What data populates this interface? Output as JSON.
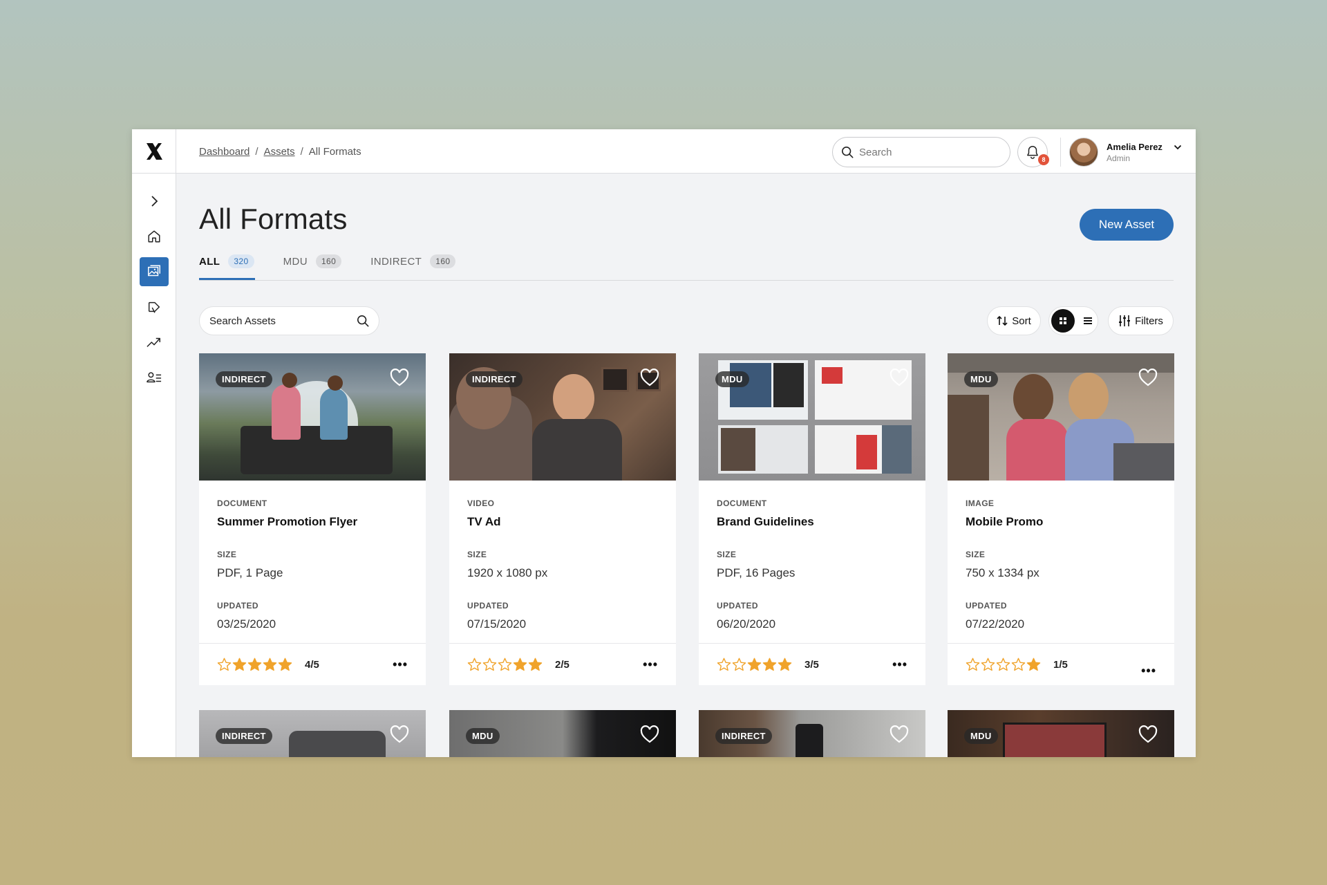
{
  "header": {
    "breadcrumb": [
      "Dashboard",
      "Assets",
      "All Formats"
    ],
    "search_placeholder": "Search",
    "notification_count": "8",
    "user": {
      "name": "Amelia Perez",
      "role": "Admin"
    }
  },
  "sidebar": {
    "items": [
      {
        "icon": "chevron-right-icon"
      },
      {
        "icon": "home-icon"
      },
      {
        "icon": "image-gallery-icon",
        "active": true
      },
      {
        "icon": "megaphone-icon"
      },
      {
        "icon": "trending-up-icon"
      },
      {
        "icon": "user-list-icon"
      }
    ]
  },
  "main": {
    "title": "All Formats",
    "new_asset_label": "New Asset",
    "tabs": [
      {
        "label": "ALL",
        "count": "320",
        "active": true
      },
      {
        "label": "MDU",
        "count": "160"
      },
      {
        "label": "INDIRECT",
        "count": "160"
      }
    ],
    "search_assets_placeholder": "Search Assets",
    "sort_label": "Sort",
    "filters_label": "Filters",
    "size_label": "SIZE",
    "updated_label": "UPDATED"
  },
  "cards": [
    {
      "tag": "INDIRECT",
      "type": "DOCUMENT",
      "title": "Summer Promotion Flyer",
      "size": "PDF, 1 Page",
      "updated": "03/25/2020",
      "rating_text": "4/5",
      "rating": 4
    },
    {
      "tag": "INDIRECT",
      "type": "VIDEO",
      "title": "TV Ad",
      "size": "1920 x 1080 px",
      "updated": "07/15/2020",
      "rating_text": "2/5",
      "rating": 2
    },
    {
      "tag": "MDU",
      "type": "DOCUMENT",
      "title": "Brand Guidelines",
      "size": "PDF, 16 Pages",
      "updated": "06/20/2020",
      "rating_text": "3/5",
      "rating": 3
    },
    {
      "tag": "MDU",
      "type": "IMAGE",
      "title": "Mobile Promo",
      "size": "750 x 1334 px",
      "updated": "07/22/2020",
      "rating_text": "1/5",
      "rating": 1
    }
  ],
  "row2_tags": [
    "INDIRECT",
    "MDU",
    "INDIRECT",
    "MDU"
  ],
  "colors": {
    "accent": "#2d6fb6",
    "star": "#f0a32b",
    "badge": "#e2533a"
  }
}
